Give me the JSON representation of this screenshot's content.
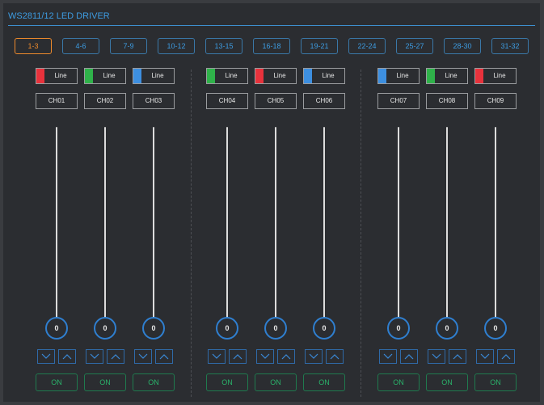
{
  "title": "WS2811/12 LED DRIVER",
  "tabs": [
    "1-3",
    "4-6",
    "7-9",
    "10-12",
    "13-15",
    "16-18",
    "19-21",
    "22-24",
    "25-27",
    "28-30",
    "31-32"
  ],
  "active_tab": "1-3",
  "colors": {
    "accent": "#3d9be0",
    "active": "#ee8a2c",
    "on": "#2ab26a",
    "red": "#e8323c",
    "green": "#2fb24a",
    "blue": "#3d8fe0"
  },
  "channels": [
    {
      "line": "Line",
      "color": "#e8323c",
      "name": "CH01",
      "value": "0",
      "on": "ON"
    },
    {
      "line": "Line",
      "color": "#2fb24a",
      "name": "CH02",
      "value": "0",
      "on": "ON"
    },
    {
      "line": "Line",
      "color": "#3d8fe0",
      "name": "CH03",
      "value": "0",
      "on": "ON"
    },
    {
      "line": "Line",
      "color": "#2fb24a",
      "name": "CH04",
      "value": "0",
      "on": "ON"
    },
    {
      "line": "Line",
      "color": "#e8323c",
      "name": "CH05",
      "value": "0",
      "on": "ON"
    },
    {
      "line": "Line",
      "color": "#3d8fe0",
      "name": "CH06",
      "value": "0",
      "on": "ON"
    },
    {
      "line": "Line",
      "color": "#3d8fe0",
      "name": "CH07",
      "value": "0",
      "on": "ON"
    },
    {
      "line": "Line",
      "color": "#2fb24a",
      "name": "CH08",
      "value": "0",
      "on": "ON"
    },
    {
      "line": "Line",
      "color": "#e8323c",
      "name": "CH09",
      "value": "0",
      "on": "ON"
    }
  ]
}
